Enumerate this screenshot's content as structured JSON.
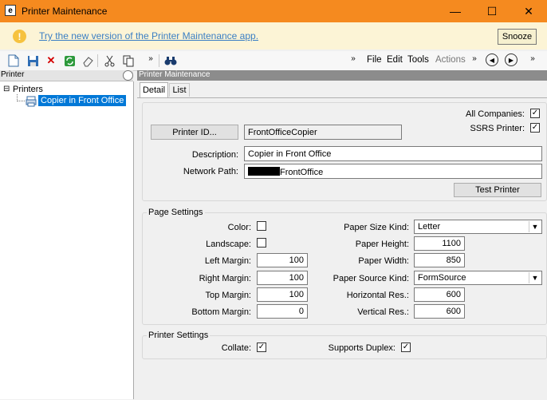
{
  "window": {
    "title": "Printer Maintenance",
    "app_icon_letter": "e"
  },
  "banner": {
    "message": "Try the new version of the Printer Maintenance app.",
    "snooze_label": "Snooze"
  },
  "toolbar": {
    "menus": [
      "File",
      "Edit",
      "Tools",
      "Actions"
    ],
    "overflow": "»"
  },
  "left_panel": {
    "header": "Printer",
    "tree": {
      "root": "Printers",
      "child": "Copier in Front Office"
    }
  },
  "right_panel": {
    "header": "Printer Maintenance",
    "tabs": [
      "Detail",
      "List"
    ],
    "detail": {
      "printer_id_button": "Printer ID...",
      "printer_id_value": "FrontOfficeCopier",
      "all_companies_label": "All Companies:",
      "all_companies_checked": true,
      "ssrs_label": "SSRS Printer:",
      "ssrs_checked": true,
      "description_label": "Description:",
      "description_value": "Copier in Front Office",
      "network_path_label": "Network Path:",
      "network_path_value": "FrontOffice",
      "test_printer_button": "Test Printer"
    },
    "page_settings": {
      "title": "Page Settings",
      "color_label": "Color:",
      "color_checked": false,
      "landscape_label": "Landscape:",
      "landscape_checked": false,
      "left_margin_label": "Left Margin:",
      "left_margin": "100",
      "right_margin_label": "Right Margin:",
      "right_margin": "100",
      "top_margin_label": "Top Margin:",
      "top_margin": "100",
      "bottom_margin_label": "Bottom Margin:",
      "bottom_margin": "0",
      "paper_size_kind_label": "Paper Size Kind:",
      "paper_size_kind": "Letter",
      "paper_height_label": "Paper Height:",
      "paper_height": "1100",
      "paper_width_label": "Paper Width:",
      "paper_width": "850",
      "paper_source_kind_label": "Paper Source Kind:",
      "paper_source_kind": "FormSource",
      "horizontal_res_label": "Horizontal Res.:",
      "horizontal_res": "600",
      "vertical_res_label": "Vertical Res.:",
      "vertical_res": "600"
    },
    "printer_settings": {
      "title": "Printer Settings",
      "collate_label": "Collate:",
      "collate_checked": true,
      "duplex_label": "Supports Duplex:",
      "duplex_checked": true
    }
  },
  "colors": {
    "title_bar": "#f58a1f",
    "banner_bg": "#fcf4d6",
    "link": "#3b7fc4",
    "selection": "#0078d7"
  },
  "glyphs": {
    "check": "✓",
    "minimize": "—",
    "maximize": "☐",
    "close": "✕",
    "dropdown": "▼",
    "tree_minus": "⊟",
    "info": "!",
    "back": "◀",
    "forward": "▶"
  }
}
